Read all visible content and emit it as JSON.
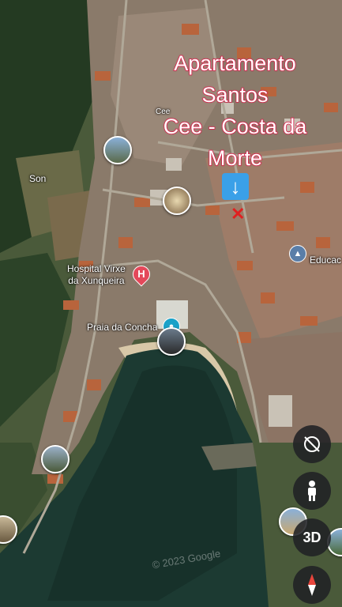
{
  "overlay": {
    "title_lines": [
      "Apartamento",
      "Santos",
      "Cee - Costa da",
      "Morte"
    ]
  },
  "map_labels": {
    "son": "Son",
    "cee": "Cee",
    "hospital_line1": "Hospital Virxe",
    "hospital_line2": "da Xunqueira",
    "praia": "Praia da Concha",
    "educ": "Educac"
  },
  "watermark": "© 2023 Google",
  "controls": {
    "three_d_label": "3D"
  },
  "icons": {
    "location_arrow": "down-arrow-icon",
    "location_marker": "x-marker-icon",
    "hospital": "hospital-icon",
    "education": "education-icon",
    "camera": "camera-icon",
    "compass": "compass-icon",
    "pegman": "pegman-icon",
    "rotate": "rotate-lock-icon"
  },
  "colors": {
    "title_stroke": "#d8204a",
    "arrow_bg": "#3aa0e8",
    "marker": "#e02020",
    "hospital": "#e4485a",
    "camera": "#1aa1c8"
  }
}
